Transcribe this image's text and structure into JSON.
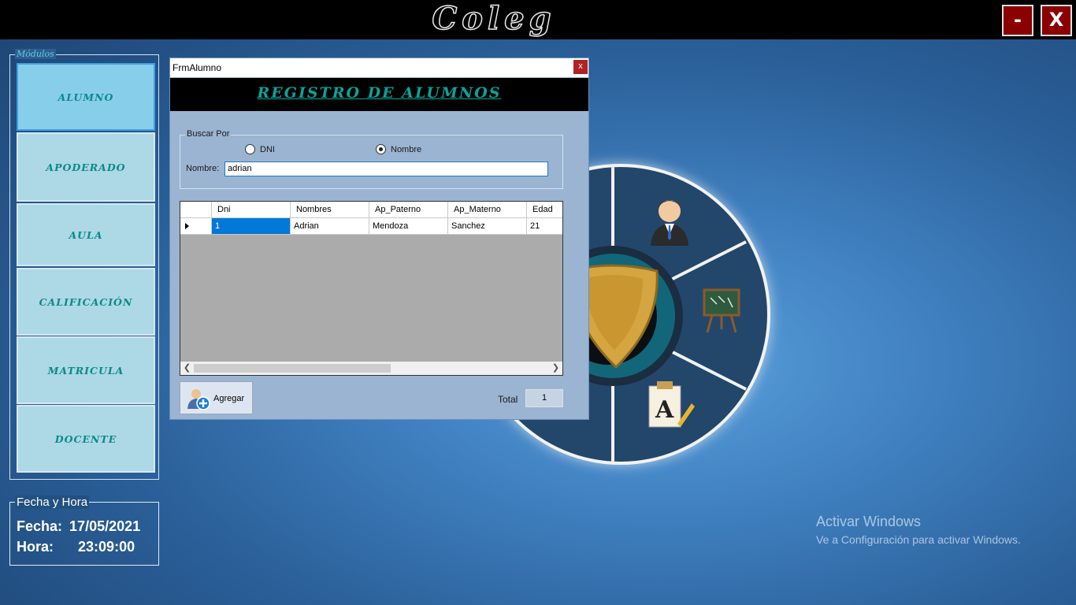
{
  "app": {
    "logo_text": "Coleg",
    "minimize_label": "-",
    "close_label": "X"
  },
  "modules": {
    "legend": "Módulos",
    "items": [
      {
        "label": "ALUMNO",
        "active": true
      },
      {
        "label": "APODERADO",
        "active": false
      },
      {
        "label": "AULA",
        "active": false
      },
      {
        "label": "CALIFICACIÓN",
        "active": false
      },
      {
        "label": "MATRICULA",
        "active": false
      },
      {
        "label": "DOCENTE",
        "active": false
      }
    ]
  },
  "datetime": {
    "legend": "Fecha y Hora",
    "fecha_label": "Fecha:",
    "fecha_value": "17/05/2021",
    "hora_label": "Hora:",
    "hora_value": "23:09:00"
  },
  "form": {
    "window_title": "FrmAlumno",
    "close_label": "x",
    "header": "REGISTRO DE ALUMNOS",
    "search": {
      "legend": "Buscar Por",
      "option_dni": "DNI",
      "option_nombre": "Nombre",
      "selected": "Nombre",
      "nombre_label": "Nombre:",
      "nombre_value": "adrian"
    },
    "table": {
      "columns": [
        "Dni",
        "Nombres",
        "Ap_Paterno",
        "Ap_Materno",
        "Edad"
      ],
      "rows": [
        [
          "1",
          "Adrian",
          "Mendoza",
          "Sanchez",
          "21"
        ]
      ]
    },
    "add_button": "Agregar",
    "total_label": "Total",
    "total_value": "1"
  },
  "watermark": {
    "title": "Activar Windows",
    "subtitle": "Ve a Configuración para activar Windows."
  },
  "colors": {
    "module_button": "#add8e6",
    "module_active": "#87ceeb",
    "module_text": "#0a8a8a",
    "header_text": "#0aa39a",
    "selected_cell": "#0078d7"
  }
}
